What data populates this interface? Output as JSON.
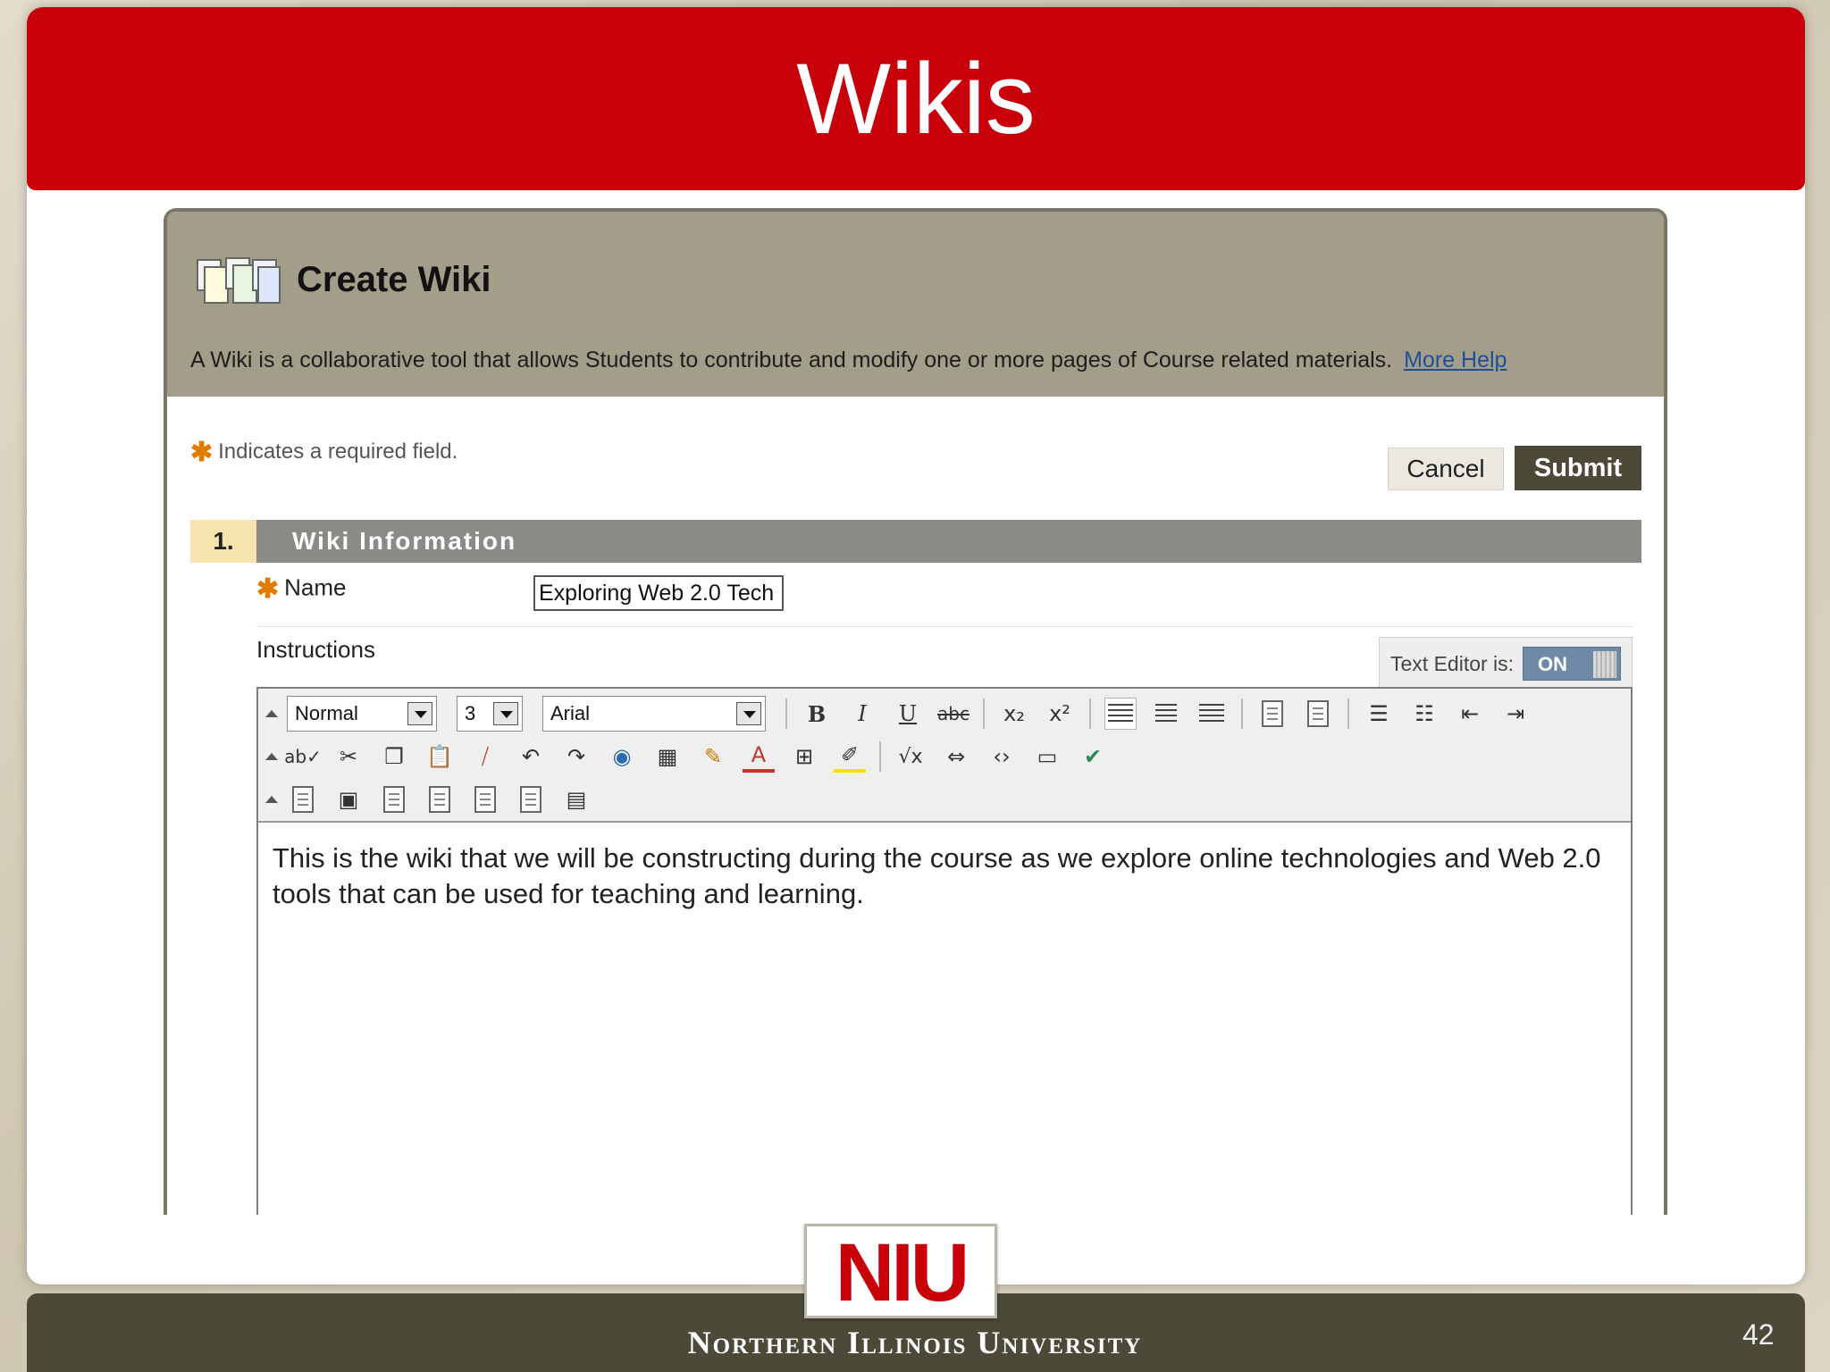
{
  "slide": {
    "title": "Wikis",
    "page_number": "42",
    "footer": "Northern Illinois University",
    "logo": "NIU"
  },
  "page": {
    "title": "Create Wiki",
    "description": "A Wiki is a collaborative tool that allows Students to contribute and modify one or more pages of Course related materials.",
    "help_link": "More Help",
    "required_note": "Indicates a required field.",
    "cancel_label": "Cancel",
    "submit_label": "Submit"
  },
  "section": {
    "number": "1.",
    "title": "Wiki Information",
    "name_label": "Name",
    "name_value": "Exploring Web 2.0 Tech",
    "instructions_label": "Instructions"
  },
  "editor": {
    "toggle_label": "Text Editor is:",
    "toggle_state": "ON",
    "format": "Normal",
    "size": "3",
    "font": "Arial",
    "content": "This is the wiki that we will be constructing during the course as we explore online technologies  and Web 2.0 tools that can be used for teaching and learning."
  },
  "colors": {
    "title_band": "#c8000a",
    "header_bg": "#a29e8a",
    "submit_bg": "#4c4939",
    "section_bar": "#8c8a87",
    "required_star": "#e07b00",
    "footer_band": "#4b4a38"
  }
}
